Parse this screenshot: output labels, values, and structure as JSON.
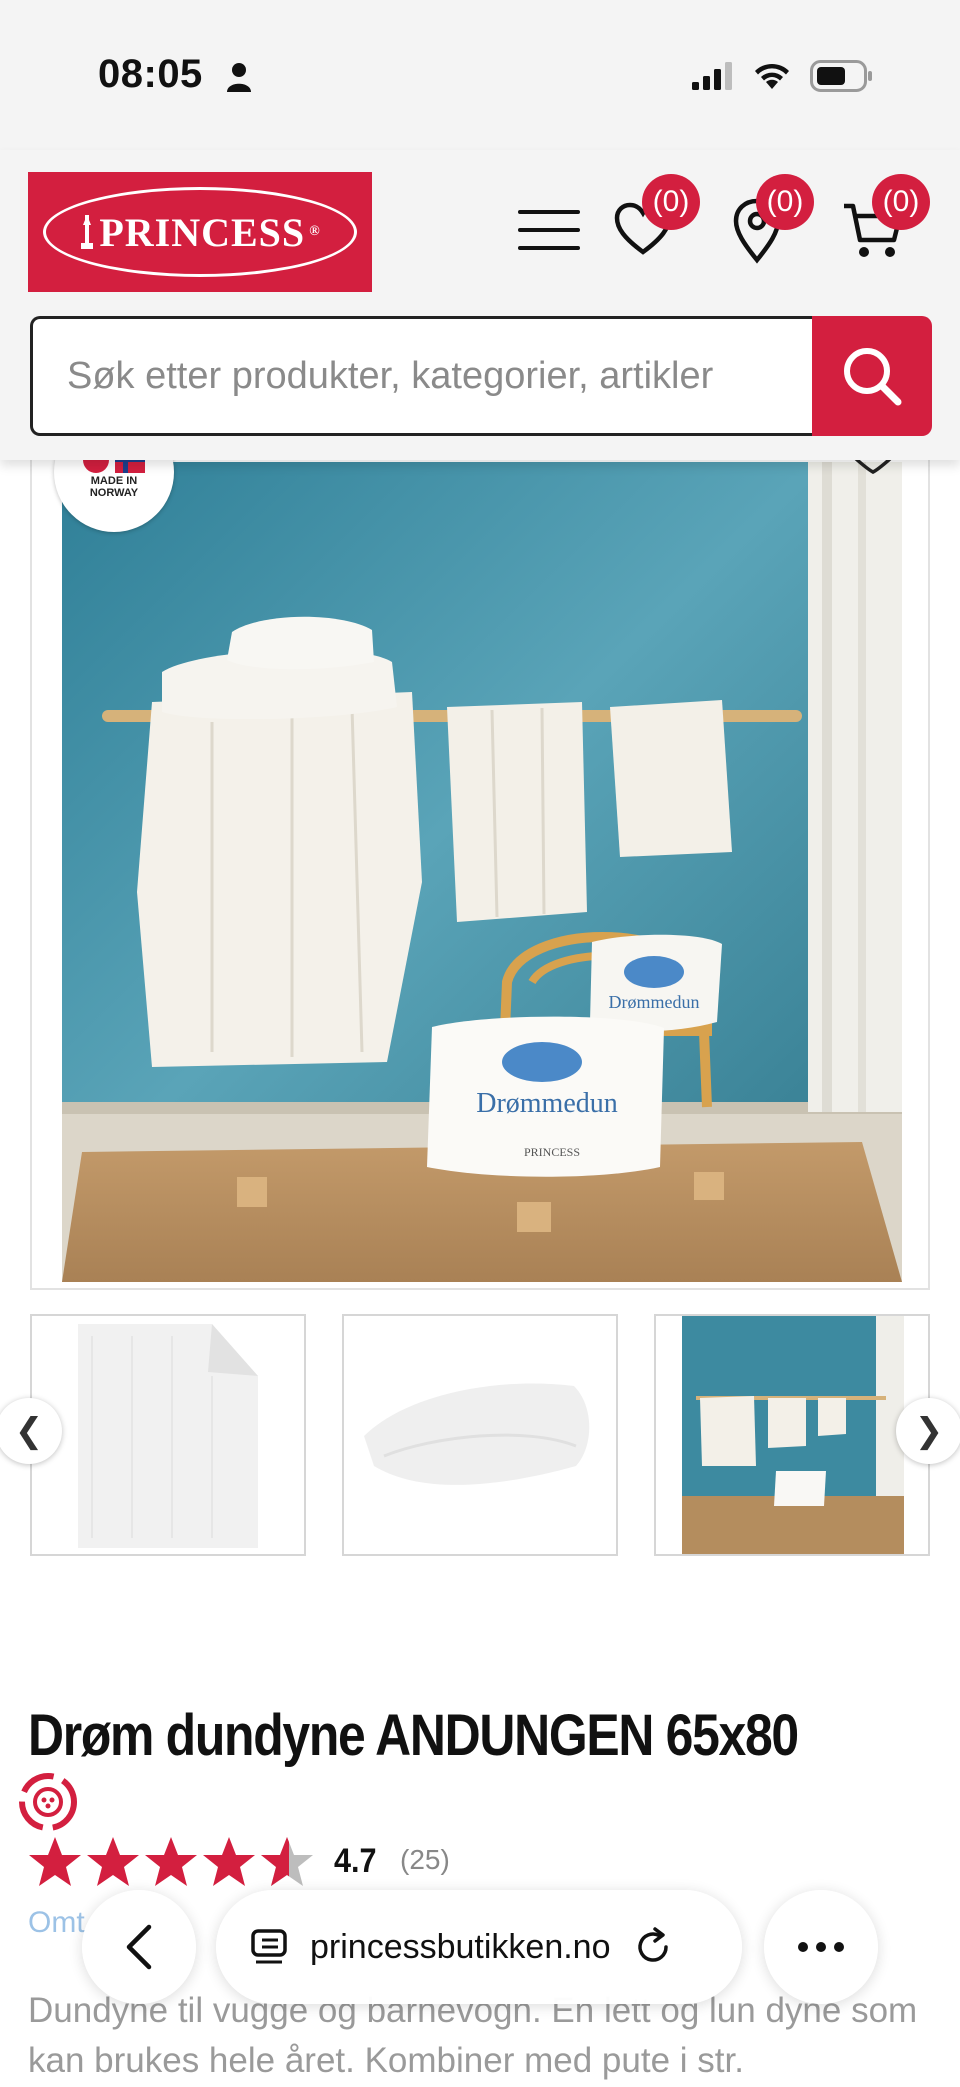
{
  "status_bar": {
    "time": "08:05"
  },
  "header": {
    "logo_text": "PRINCESS",
    "logo_mark": "®",
    "wishlist_count": "(0)",
    "store_count": "(0)",
    "cart_count": "(0)",
    "brand_color": "#d31f3f"
  },
  "search": {
    "placeholder": "Søk etter produkter, kategorier, artikler",
    "value": ""
  },
  "product": {
    "badge_line1": "MADE IN",
    "badge_line2": "NORWAY",
    "pillow_brand_1": "Drømmedun",
    "pillow_brand_2": "Drømmedun",
    "pillow_maker": "PRINCESS",
    "title": "Drøm dundyne ANDUNGEN 65x80",
    "rating_value": "4.7",
    "rating_count": "(25)",
    "rating_fraction": 0.94,
    "omtale_label": "Omt",
    "description": "Dundyne til vugge og barnevogn. En lett og lun dyne som kan brukes hele året. Kombiner med pute i str."
  },
  "gallery": {
    "prev_label": "❮",
    "next_label": "❯"
  },
  "browser": {
    "url": "princessbutikken.no"
  }
}
